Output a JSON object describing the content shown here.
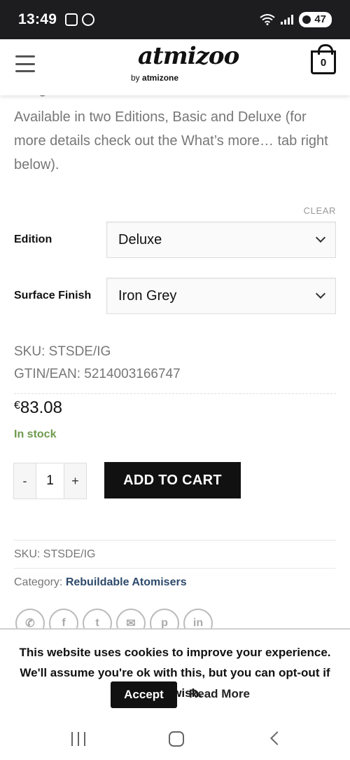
{
  "status_bar": {
    "time": "13:49",
    "battery": "47",
    "icons": [
      "screenshot-icon",
      "whatsapp-icon",
      "wifi-icon",
      "signal-icon",
      "battery-icon"
    ]
  },
  "header": {
    "logo_text": "atmizoo",
    "logo_sub_prefix": "by ",
    "logo_sub_brand": "atmizone",
    "cart_count": "0"
  },
  "product": {
    "description_cut": "bridge.",
    "description": "Available in two Editions, Basic and Deluxe (for more details check out the What’s more… tab right below).",
    "clear_label": "CLEAR",
    "variations": [
      {
        "label": "Edition",
        "value": "Deluxe"
      },
      {
        "label": "Surface Finish",
        "value": "Iron Grey"
      }
    ],
    "sku_line": "SKU: STSDE/IG",
    "gtin_line": "GTIN/EAN: 5214003166747",
    "price_currency": "€",
    "price_value": "83.08",
    "stock": "In stock",
    "quantity": "1",
    "qty_minus": "-",
    "qty_plus": "+",
    "add_to_cart": "ADD TO CART",
    "meta_sku": "SKU: STSDE/IG",
    "meta_category_label": "Category: ",
    "meta_category_value": "Rebuildable Atomisers"
  },
  "share": [
    "whatsapp-icon",
    "facebook-icon",
    "twitter-icon",
    "email-icon",
    "pinterest-icon",
    "linkedin-icon"
  ],
  "cookie": {
    "text": "This website uses cookies to improve your experience. We'll assume you're ok with this, but you can opt-out if you wish.",
    "accept": "Accept",
    "read_more": "Read More"
  },
  "colors": {
    "accent_black": "#111111",
    "stock_green": "#6f9b4f",
    "link_blue": "#2e4a6b"
  }
}
